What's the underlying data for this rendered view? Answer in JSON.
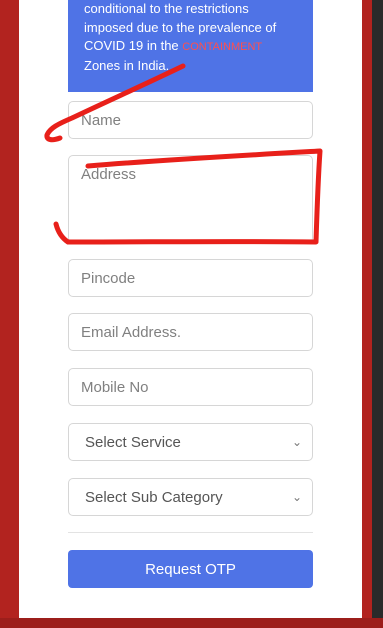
{
  "notice": {
    "line1": "conditional to the restrictions",
    "line2": "imposed due to the prevalence of",
    "line3_prefix": "COVID 19 in the ",
    "line3_highlight": "CONTAINMENT",
    "line4": "Zones in India."
  },
  "form": {
    "name_placeholder": "Name",
    "address_placeholder": "Address",
    "pincode_placeholder": "Pincode",
    "email_placeholder": "Email Address.",
    "mobile_placeholder": "Mobile No",
    "service_select": "Select Service",
    "subcategory_select": "Select Sub Category",
    "submit_label": "Request OTP"
  },
  "colors": {
    "accent": "#4f73e6",
    "frame_red": "#b2231f",
    "highlight_red": "#ff4f4f",
    "annotation_red": "#e8201a"
  },
  "icons": {
    "select_chevron": "chevron-down-icon"
  }
}
